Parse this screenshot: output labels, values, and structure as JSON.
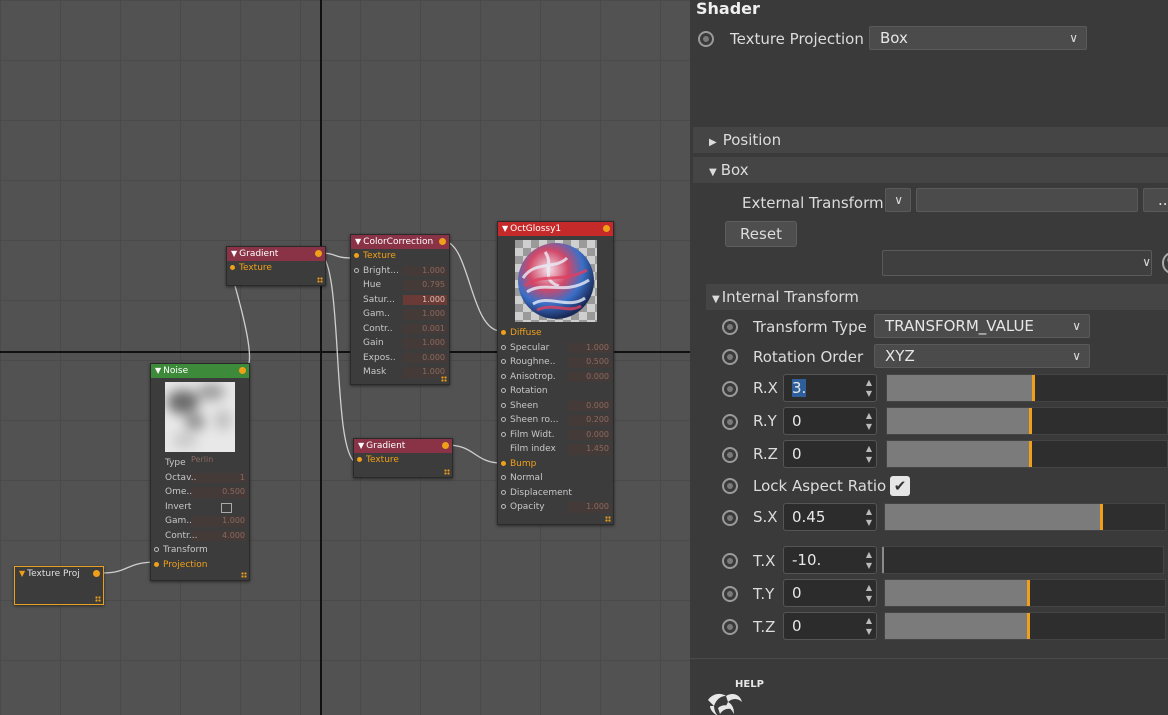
{
  "graph": {
    "nodes": {
      "gradient1": {
        "title": "Gradient",
        "rows": [
          "Texture"
        ],
        "color": "#8a3347"
      },
      "noise": {
        "title": "Noise",
        "color": "#3d8a3a",
        "rows": [
          {
            "label": "Type",
            "value": "Perlin"
          },
          {
            "label": "Octav..",
            "value": "1"
          },
          {
            "label": "Ome..",
            "value": "0.500"
          },
          {
            "label": "Invert",
            "value": ""
          },
          {
            "label": "Gam..",
            "value": "1.000"
          },
          {
            "label": "Contr...",
            "value": "4.000"
          },
          {
            "label": "Transform",
            "value": ""
          },
          {
            "label": "Projection",
            "value": ""
          }
        ]
      },
      "colorcorrection": {
        "title": "ColorCorrection",
        "color": "#8a3347",
        "rows": [
          {
            "label": "Texture",
            "value": ""
          },
          {
            "label": "Bright...",
            "value": "1.000"
          },
          {
            "label": "Hue",
            "value": "0.795"
          },
          {
            "label": "Satur...",
            "value": "1.000"
          },
          {
            "label": "Gam..",
            "value": "1.000"
          },
          {
            "label": "Contr..",
            "value": "0.001"
          },
          {
            "label": "Gain",
            "value": "1.000"
          },
          {
            "label": "Expos..",
            "value": "0.000"
          },
          {
            "label": "Mask",
            "value": "1.000"
          }
        ]
      },
      "gradient2": {
        "title": "Gradient",
        "rows": [
          "Texture"
        ],
        "color": "#8a3347"
      },
      "octglossy": {
        "title": "OctGlossy1",
        "color": "#c42a2a",
        "rows": [
          {
            "label": "Diffuse",
            "value": ""
          },
          {
            "label": "Specular",
            "value": "1.000"
          },
          {
            "label": "Roughne..",
            "value": "0.500"
          },
          {
            "label": "Anisotrop.",
            "value": "0.000"
          },
          {
            "label": "Rotation",
            "value": ""
          },
          {
            "label": "Sheen",
            "value": "0.000"
          },
          {
            "label": "Sheen ro...",
            "value": "0.200"
          },
          {
            "label": "Film Widt.",
            "value": "0.000"
          },
          {
            "label": "Film index",
            "value": "1.450"
          },
          {
            "label": "Bump",
            "value": ""
          },
          {
            "label": "Normal",
            "value": ""
          },
          {
            "label": "Displacement",
            "value": ""
          },
          {
            "label": "Opacity",
            "value": "1.000"
          }
        ]
      },
      "textureproj": {
        "title": "Texture Proj"
      }
    }
  },
  "panel": {
    "title": "Shader",
    "texture_projection": {
      "label": "Texture Projection",
      "value": "Box"
    },
    "sections": {
      "position": "Position",
      "box": "Box",
      "internal": "Internal Transform"
    },
    "external_transform": {
      "label": "External Transform",
      "browse": "..."
    },
    "reset_label": "Reset",
    "transform_type": {
      "label": "Transform Type",
      "value": "TRANSFORM_VALUE"
    },
    "rotation_order": {
      "label": "Rotation Order",
      "value": "XYZ"
    },
    "params": {
      "rx": {
        "label": "R.X",
        "value": "3.",
        "level": 0.52
      },
      "ry": {
        "label": "R.Y",
        "value": "0",
        "level": 0.51
      },
      "rz": {
        "label": "R.Z",
        "value": "0",
        "level": 0.51
      },
      "sx": {
        "label": "S.X",
        "value": "0.45",
        "level": 0.77
      },
      "tx": {
        "label": "T.X",
        "value": "-10.",
        "level": 0.0
      },
      "ty": {
        "label": "T.Y",
        "value": "0",
        "level": 0.51
      },
      "tz": {
        "label": "T.Z",
        "value": "0",
        "level": 0.51
      }
    },
    "lock_aspect": {
      "label": "Lock Aspect Ratio",
      "checked": true
    },
    "help_label": "HELP"
  },
  "colors": {
    "accent": "#f0a018",
    "panel_bg": "#3a3a3a",
    "graph_bg": "#525252"
  }
}
